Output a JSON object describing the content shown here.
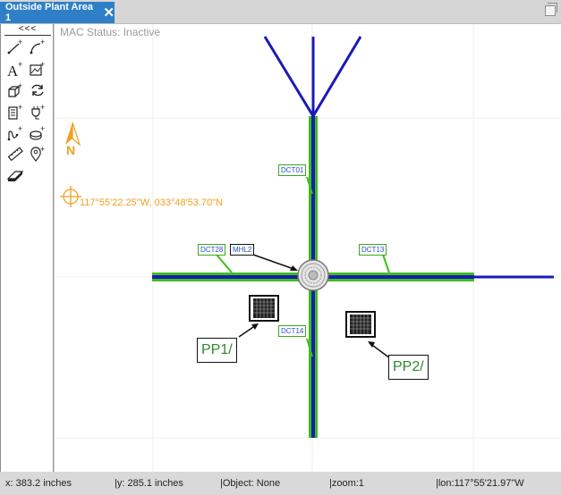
{
  "tab": {
    "title": "Outside Plant Area 1",
    "close_glyph": "✕"
  },
  "toolbar": {
    "collapse_label": "<<<",
    "tools": [
      {
        "name": "add-line-tool",
        "icon": "line-plus-icon"
      },
      {
        "name": "add-arc-tool",
        "icon": "arc-plus-icon"
      },
      {
        "name": "add-text-tool",
        "icon": "text-plus-icon",
        "glyph": "A"
      },
      {
        "name": "add-image-tool",
        "icon": "image-plus-icon"
      },
      {
        "name": "add-object-tool",
        "icon": "cube-plus-icon"
      },
      {
        "name": "refresh-tool",
        "icon": "refresh-icon"
      },
      {
        "name": "add-cabinet-tool",
        "icon": "cabinet-plus-icon"
      },
      {
        "name": "add-plug-tool",
        "icon": "plug-plus-icon"
      },
      {
        "name": "add-route-tool",
        "icon": "route-plus-icon"
      },
      {
        "name": "add-disc-tool",
        "icon": "disc-plus-icon"
      },
      {
        "name": "measure-tool",
        "icon": "ruler-icon"
      },
      {
        "name": "add-location-tool",
        "icon": "location-plus-icon"
      },
      {
        "name": "eraser-tool",
        "icon": "eraser-icon"
      }
    ]
  },
  "canvas": {
    "mac_status": "MAC Status: Inactive",
    "north_label": "N",
    "coordinates": "117°55'22.25\"W, 033°48'53.70\"N",
    "ducts": {
      "dct01": "DCT01",
      "dct28": "DCT28",
      "dct13": "DCT13",
      "dct14": "DCT14"
    },
    "manhole": "MHL2",
    "pp1": "PP1/",
    "pp2": "PP2/",
    "colors": {
      "duct_blue": "#1a1ab8",
      "duct_green": "#3cbf1a",
      "compass": "#f0a020"
    }
  },
  "status": {
    "x": "x: 383.2 inches",
    "y": "|y: 285.1 inches",
    "object": "|Object: None",
    "zoom": "|zoom:1",
    "lon": "|lon:117°55'21.97\"W"
  }
}
